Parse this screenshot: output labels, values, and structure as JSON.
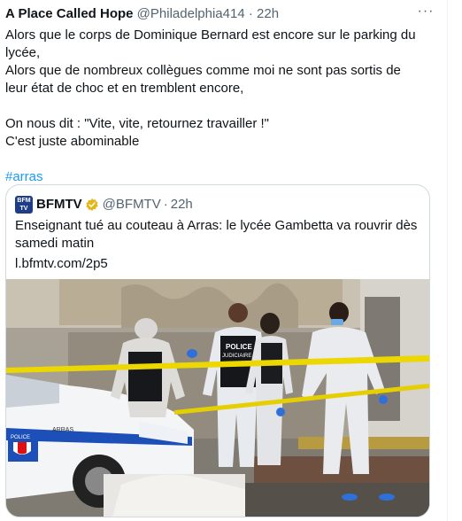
{
  "tweet": {
    "author_name": "A Place Called Hope",
    "author_handle": "@Philadelphia414",
    "dot": "·",
    "time": "22h",
    "more_label": "···",
    "lines": [
      "Alors que le corps de Dominique Bernard est encore sur le parking du lycée,",
      "Alors que de nombreux collègues comme moi ne sont pas sortis de leur état de choc et en tremblent encore,",
      "On nous dit : \"Vite, vite, retournez travailler !\"",
      "C'est juste abominable"
    ],
    "hashtag": "#arras"
  },
  "quote": {
    "avatar_text_top": "BFM",
    "avatar_text_bottom": "TV",
    "name": "BFMTV",
    "handle": "@BFMTV",
    "dot": "·",
    "time": "22h",
    "text": "Enseignant tué au couteau à Arras: le lycée Gambetta va rouvrir dès samedi matin",
    "link": "l.bfmtv.com/2p5",
    "photo_labels": {
      "vest": "POLICE",
      "vest_sub": "JUDICIAIRE",
      "car_police": "POLICE",
      "car_city": "ARRAS"
    }
  },
  "colors": {
    "text": "#0f1419",
    "secondary": "#536471",
    "accent": "#1d9bf0",
    "border": "#cfd9de",
    "verified_gold": "#e2b719"
  }
}
